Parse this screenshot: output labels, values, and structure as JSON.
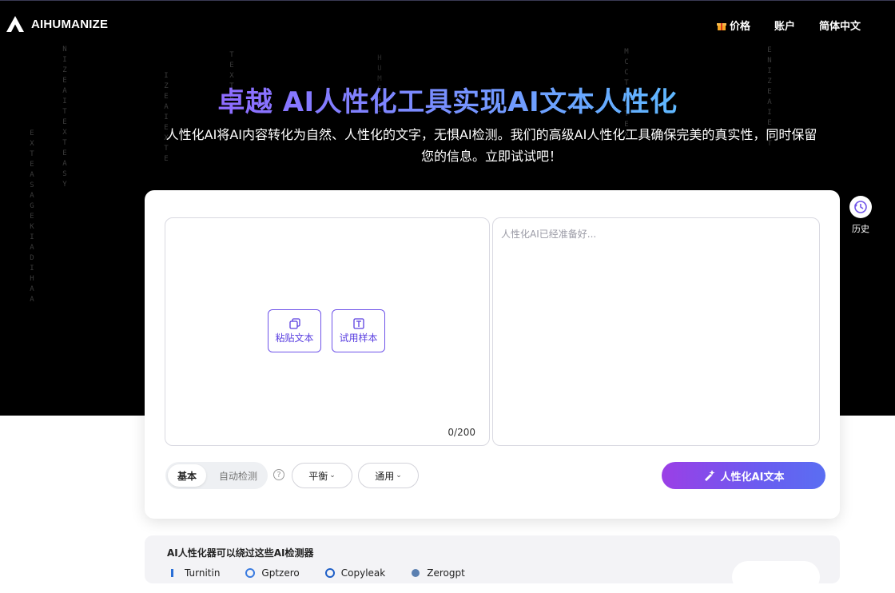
{
  "brand": {
    "name": "AIHUMANIZE"
  },
  "nav": {
    "pricing": "价格",
    "account": "账户",
    "language": "简体中文"
  },
  "hero": {
    "title": "卓越 AI人性化工具实现AI文本人性化",
    "subtitle_line1": "人性化AI将AI内容转化为自然、人性化的文字，无惧AI检测。我们的高级AI人性化工具确保完美的真实性，同时保留",
    "subtitle_line2": "您的信息。立即试试吧！"
  },
  "editor": {
    "paste_label": "粘贴文本",
    "sample_label": "试用样本",
    "char_count": "0/200",
    "output_placeholder": "人性化AI已经准备好..."
  },
  "toolbar": {
    "mode_basic": "基本",
    "mode_auto": "自动检测",
    "help": "?",
    "tone": "平衡",
    "purpose": "通用",
    "submit": "人性化AI文本"
  },
  "history": {
    "label": "历史"
  },
  "bypass": {
    "title": "AI人性化器可以绕过这些AI检测器",
    "detectors": [
      "Turnitin",
      "Gptzero",
      "Copyleak",
      "Zerogpt"
    ]
  },
  "colors": {
    "accent": "#6f54e9",
    "gradient_start": "#9b3fe6",
    "gradient_end": "#5a6ef2",
    "hero_bg": "#000000"
  }
}
